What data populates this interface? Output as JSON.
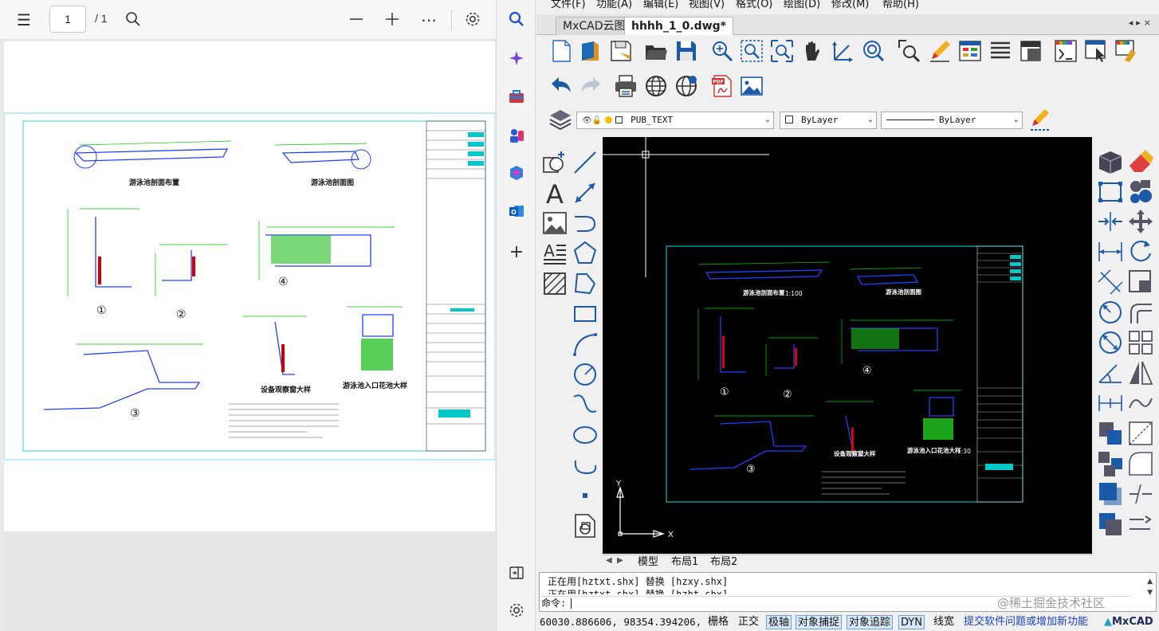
{
  "pdf_viewer": {
    "current_page": "1",
    "total_pages": "/ 1",
    "icons": [
      "table-of-contents-icon",
      "search-icon",
      "zoom-out-icon",
      "zoom-in-icon",
      "more-options-icon",
      "settings-icon"
    ]
  },
  "edge_sidebar": {
    "icons": [
      "search-icon",
      "copilot-icon",
      "tools-icon",
      "games-icon",
      "office-icon",
      "outlook-icon",
      "add-icon",
      "split-screen-icon",
      "settings-icon"
    ]
  },
  "cad": {
    "menu": [
      "文件(F)",
      "功能(A)",
      "编辑(E)",
      "视图(V)",
      "格式(O)",
      "绘图(D)",
      "修改(M)",
      "帮助(H)"
    ],
    "tabs": [
      {
        "label": "MxCAD云图"
      },
      {
        "label": "hhhh_1_0.dwg*"
      }
    ],
    "layer_combo": "PUB_TEXT",
    "color_combo": "ByLayer",
    "linetype_combo": "ByLayer",
    "layout_tabs": [
      "模型",
      "布局1",
      "布局2"
    ],
    "command_history": [
      "正在用[hztxt.shx] 替换 [hzxy.shx]",
      "正在用[hztxt.shx] 替换 [hzht.shx]"
    ],
    "command_prompt": "命令:",
    "status": {
      "coords": "60030.886606, 98354.394206,",
      "toggles": [
        {
          "label": "栅格",
          "on": false
        },
        {
          "label": "正交",
          "on": false
        },
        {
          "label": "极轴",
          "on": true
        },
        {
          "label": "对象捕捉",
          "on": true
        },
        {
          "label": "对象追踪",
          "on": true
        },
        {
          "label": "DYN",
          "on": true
        },
        {
          "label": "线宽",
          "on": false
        }
      ],
      "feedback_link": "提交软件问题或增加新功能",
      "brand": "MxCAD",
      "link_color": "#1a3fc8"
    },
    "watermark": "@稀土掘金技术社区",
    "drawing_labels": {
      "plan_title": "游泳池剖面布置",
      "section_title": "游泳池剖面图",
      "scale_100": "1:100",
      "scale_30": "1:30",
      "detail_title": "游泳池入口花池大样",
      "equip_title": "设备观察窗大样",
      "markers": [
        "①",
        "②",
        "③",
        "④"
      ]
    },
    "colors": {
      "canvas_bg": "#000000",
      "frame": "#00e0e0",
      "green": "#00d000",
      "blue": "#2040ff",
      "red": "#e00000"
    }
  }
}
